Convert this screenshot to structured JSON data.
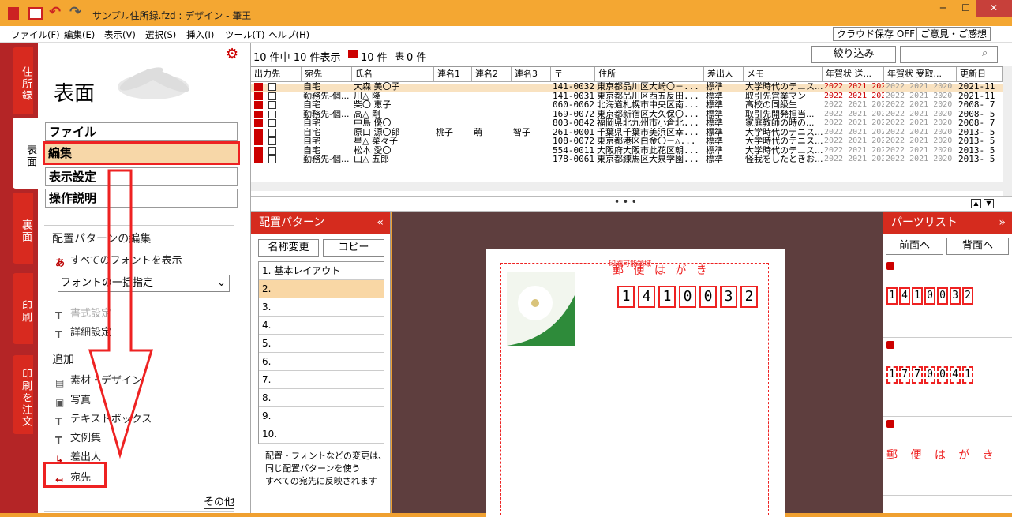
{
  "window": {
    "title": "サンプル住所録.fzd : デザイン - 筆王"
  },
  "menu": [
    "ファイル(F)",
    "編集(E)",
    "表示(V)",
    "選択(S)",
    "挿入(I)",
    "ツール(T)",
    "ヘルプ(H)"
  ],
  "menu_buttons": {
    "cloud": "クラウド保存 OFF",
    "feedback": "ご意見・ご感想"
  },
  "vtabs": [
    "住所録",
    "表面",
    "裏面",
    "印刷",
    "印刷を注文"
  ],
  "left": {
    "title": "表面",
    "menu": [
      "ファイル",
      "編集",
      "表示設定",
      "操作説明"
    ],
    "section1": "配置パターンの編集",
    "show_fonts": "すべてのフォントを表示",
    "font_select": "フォントの一括指定",
    "format": "書式設定",
    "detail": "詳細設定",
    "section2": "追加",
    "add_items": [
      "素材・デザイン",
      "写真",
      "テキストボックス",
      "文例集",
      "差出人",
      "宛先"
    ],
    "more": "その他"
  },
  "list": {
    "count_text": "10 件中 10 件表示",
    "print_count": "10 件",
    "mo_count": "0 件",
    "mo_label": "喪",
    "filter": "絞り込み",
    "headers": [
      "出力先",
      "宛先",
      "氏名",
      "連名1",
      "連名2",
      "連名3",
      "〒",
      "住所",
      "差出人",
      "メモ",
      "年賀状 送...",
      "年賀状 受取...",
      "更新日"
    ],
    "rows": [
      {
        "dest": "自宅",
        "name": "大森 美〇子",
        "r1": "",
        "r2": "",
        "r3": "",
        "zip": "141-0032",
        "addr": "東京都品川区大崎〇－...",
        "sender": "標準",
        "memo": "大学時代のテニス...",
        "date": "2021-11"
      },
      {
        "dest": "勤務先-個...",
        "name": "川△ 隆",
        "r1": "",
        "r2": "",
        "r3": "",
        "zip": "141-0031",
        "addr": "東京都品川区西五反田...",
        "sender": "標準",
        "memo": "取引先営業マン",
        "date": "2021-11"
      },
      {
        "dest": "自宅",
        "name": "柴〇 恵子",
        "r1": "",
        "r2": "",
        "r3": "",
        "zip": "060-0062",
        "addr": "北海道札幌市中央区南...",
        "sender": "標準",
        "memo": "高校の同級生",
        "date": "2008- 7"
      },
      {
        "dest": "勤務先-個...",
        "name": "高△ 剛",
        "r1": "",
        "r2": "",
        "r3": "",
        "zip": "169-0072",
        "addr": "東京都新宿区大久保〇...",
        "sender": "標準",
        "memo": "取引先開発担当...",
        "date": "2008- 5"
      },
      {
        "dest": "自宅",
        "name": "中島 優〇",
        "r1": "",
        "r2": "",
        "r3": "",
        "zip": "803-0842",
        "addr": "福岡県北九州市小倉北...",
        "sender": "標準",
        "memo": "家庭教師の時の...",
        "date": "2008- 7"
      },
      {
        "dest": "自宅",
        "name": "原口 源〇郎",
        "r1": "桃子",
        "r2": "萌",
        "r3": "智子",
        "zip": "261-0001",
        "addr": "千葉県千葉市美浜区幸...",
        "sender": "標準",
        "memo": "大学時代のテニス...",
        "date": "2013- 5"
      },
      {
        "dest": "自宅",
        "name": "星△ 菜々子",
        "r1": "",
        "r2": "",
        "r3": "",
        "zip": "108-0072",
        "addr": "東京都港区白金〇－△...",
        "sender": "標準",
        "memo": "大学時代のテニス...",
        "date": "2013- 5"
      },
      {
        "dest": "自宅",
        "name": "松本 愛〇",
        "r1": "",
        "r2": "",
        "r3": "",
        "zip": "554-0011",
        "addr": "大阪府大阪市此花区朝...",
        "sender": "標準",
        "memo": "大学時代のテニス...",
        "date": "2013- 5"
      },
      {
        "dest": "勤務先-個...",
        "name": "山△ 五郎",
        "r1": "",
        "r2": "",
        "r3": "",
        "zip": "178-0061",
        "addr": "東京都練馬区大泉学園...",
        "sender": "標準",
        "memo": "怪我をしたときお...",
        "date": "2013- 5"
      }
    ],
    "years": "2022 2021 202",
    "years2": "2022 2021 2020"
  },
  "pattern": {
    "header": "配置パターン",
    "rename": "名称変更",
    "copy": "コピー",
    "items": [
      "1. 基本レイアウト",
      "2.",
      "3.",
      "4.",
      "5.",
      "6.",
      "7.",
      "8.",
      "9.",
      "10."
    ],
    "note": [
      "配置・フォントなどの変更は、",
      "同じ配置パターンを使う",
      "すべての宛先に反映されます"
    ]
  },
  "card": {
    "print_area": "印刷可能領域",
    "hagaki": "郵 便 は が き",
    "zip": [
      "1",
      "4",
      "1",
      "0",
      "0",
      "3",
      "2"
    ]
  },
  "parts": {
    "header": "パーツリスト",
    "front": "前面へ",
    "back": "背面へ",
    "zip1": [
      "1",
      "4",
      "1",
      "0",
      "0",
      "3",
      "2"
    ],
    "zip2": [
      "1",
      "7",
      "7",
      "0",
      "0",
      "4",
      "1"
    ],
    "hagaki": "郵 便 は が き"
  },
  "colors": {
    "accent": "#d52b1e",
    "title_bar": "#f4a732"
  }
}
